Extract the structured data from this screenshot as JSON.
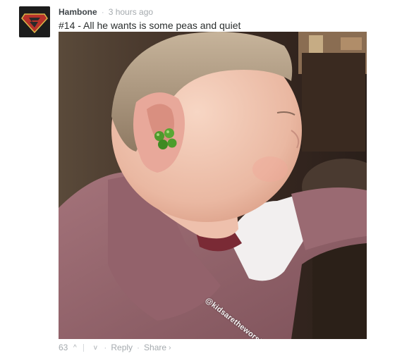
{
  "comment": {
    "author": "Hambone",
    "separator": "·",
    "time": "3 hours ago",
    "message": "#14 - All he wants is some peas and quiet",
    "image_watermark": "@kidsaretheworst"
  },
  "actions": {
    "votes": "63",
    "upvote_icon": "chevron-up-icon",
    "downvote_icon": "chevron-down-icon",
    "upvote_glyph": "^",
    "downvote_glyph": "v",
    "separator": "·",
    "reply_label": "Reply",
    "share_label": "Share",
    "share_chevron": "›"
  },
  "colors": {
    "author": "#3f4549",
    "meta": "#a5aaae",
    "message": "#2a2e2e",
    "background": "#ffffff"
  }
}
